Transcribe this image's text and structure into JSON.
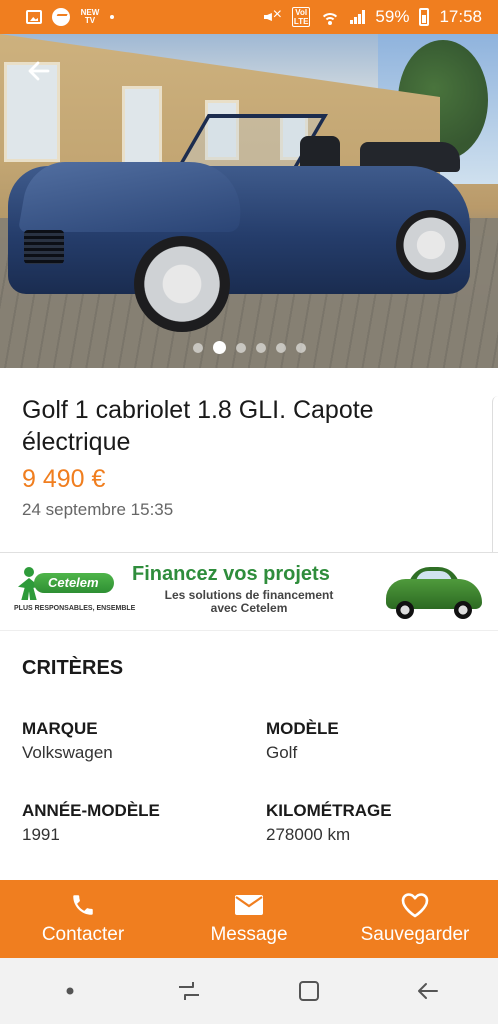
{
  "status_bar": {
    "battery": "59%",
    "time": "17:58",
    "news_badge": "NEW\nTV",
    "volte_badge": "VoI\nLTE"
  },
  "hero": {
    "photo_count": 6,
    "active_photo": 2
  },
  "ad": {
    "title": "Golf 1 cabriolet 1.8 GLI. Capote électrique",
    "price": "9 490 €",
    "date": "24 septembre 15:35"
  },
  "banner": {
    "brand": "Cetelem",
    "tagline": "PLUS RESPONSABLES, ENSEMBLE",
    "headline": "Financez vos projets",
    "subline": "Les solutions de financement avec Cetelem"
  },
  "criteria": {
    "title": "CRITÈRES",
    "items": [
      {
        "label": "MARQUE",
        "value": "Volkswagen"
      },
      {
        "label": "MODÈLE",
        "value": "Golf"
      },
      {
        "label": "ANNÉE-MODÈLE",
        "value": "1991"
      },
      {
        "label": "KILOMÉTRAGE",
        "value": "278000 km"
      }
    ]
  },
  "actions": {
    "contact": "Contacter",
    "message": "Message",
    "save": "Sauvegarder"
  },
  "colors": {
    "accent": "#f07e1f",
    "banner_green": "#2f8d3c"
  },
  "icons": {
    "back": "arrow-left-icon",
    "contact": "phone-icon",
    "message": "envelope-icon",
    "save": "heart-icon",
    "nav": [
      "dot-icon",
      "recents-icon",
      "home-icon",
      "back-nav-icon"
    ]
  }
}
